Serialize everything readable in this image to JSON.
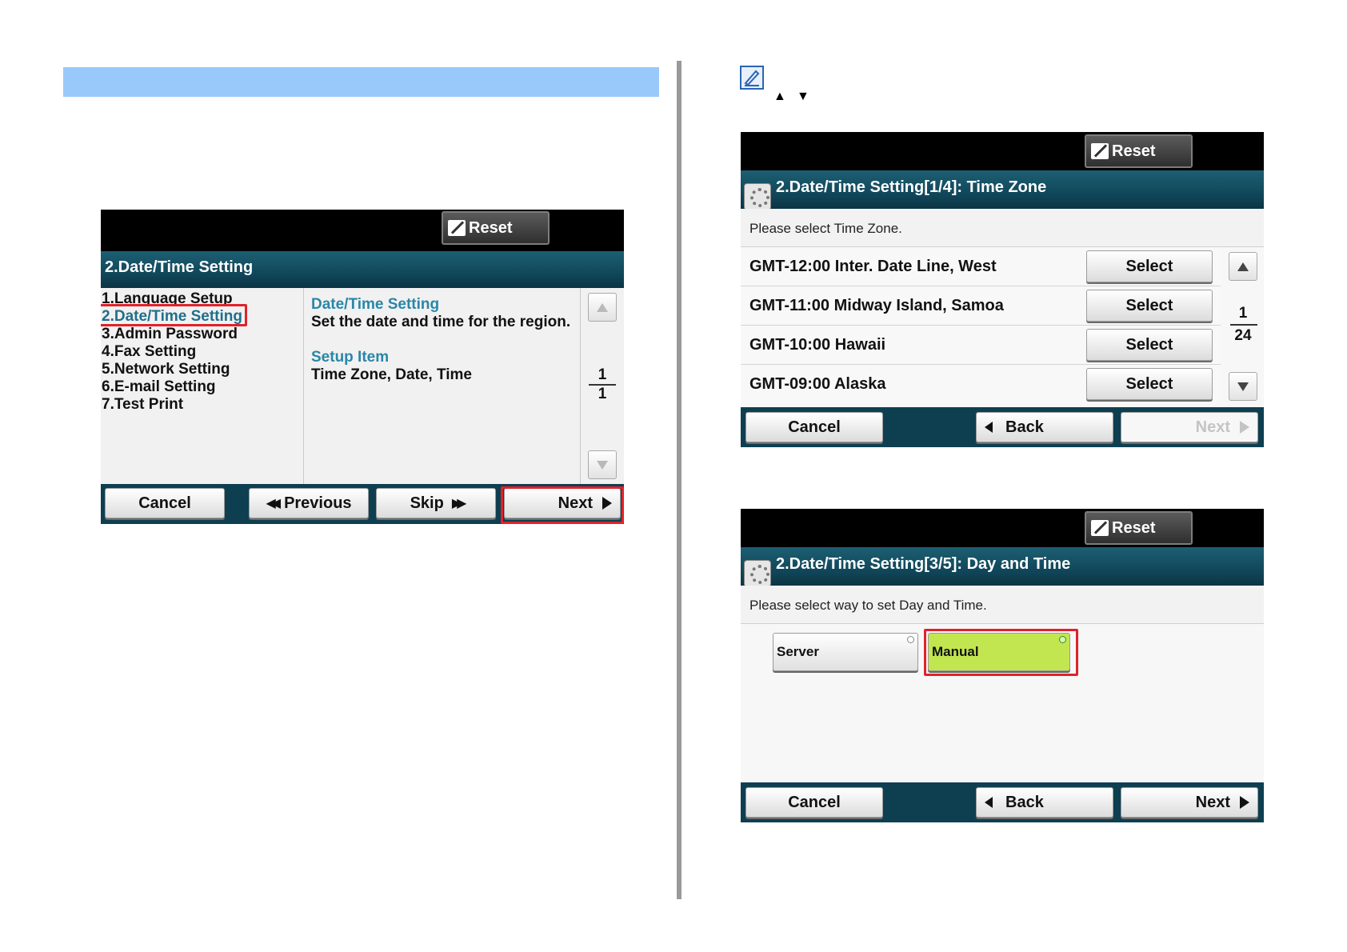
{
  "hint": {
    "up_arrow": "▲",
    "down_arrow": "▼"
  },
  "panel_a": {
    "reset_label": "Reset",
    "title": "2.Date/Time Setting",
    "menu_items": [
      "1.Language Setup",
      "2.Date/Time Setting",
      "3.Admin Password",
      "4.Fax Setting",
      "5.Network Setting",
      "6.E-mail Setting",
      "7.Test Print"
    ],
    "desc_heading": "Date/Time Setting",
    "desc_text": "Set the date and time for the region.",
    "setup_heading": "Setup Item",
    "setup_text": "Time Zone, Date, Time",
    "page_current": "1",
    "page_total": "1",
    "cancel_label": "Cancel",
    "previous_label": "Previous",
    "skip_label": "Skip",
    "next_label": "Next"
  },
  "panel_b": {
    "reset_label": "Reset",
    "title": "2.Date/Time Setting[1/4]: Time Zone",
    "prompt": "Please select Time Zone.",
    "rows": [
      {
        "label": "GMT-12:00 Inter. Date Line, West",
        "button": "Select"
      },
      {
        "label": "GMT-11:00 Midway Island, Samoa",
        "button": "Select"
      },
      {
        "label": "GMT-10:00 Hawaii",
        "button": "Select"
      },
      {
        "label": "GMT-09:00 Alaska",
        "button": "Select"
      }
    ],
    "page_current": "1",
    "page_total": "24",
    "cancel_label": "Cancel",
    "back_label": "Back",
    "next_label": "Next"
  },
  "panel_c": {
    "reset_label": "Reset",
    "title": "2.Date/Time Setting[3/5]: Day and Time",
    "prompt": "Please select way to set Day and Time.",
    "server_label": "Server",
    "manual_label": "Manual",
    "cancel_label": "Cancel",
    "back_label": "Back",
    "next_label": "Next"
  },
  "colors": {
    "highlight_red": "#e0222b",
    "manual_green": "#c2e64f",
    "title_teal": "#0f4356",
    "band_blue": "#99c9fb"
  }
}
